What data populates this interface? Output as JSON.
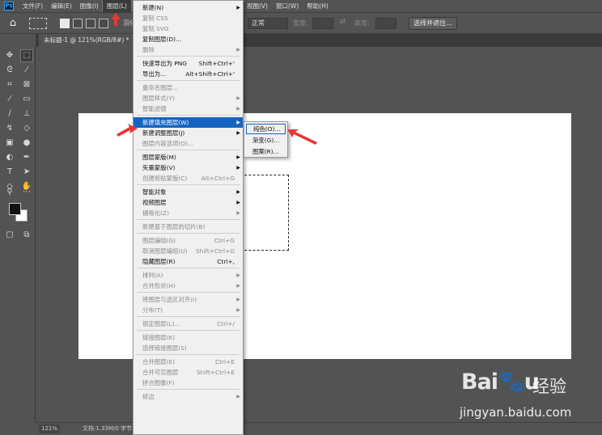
{
  "menubar": {
    "logo": "Ps",
    "items": [
      "文件(F)",
      "编辑(E)",
      "图像(I)",
      "图层(L)"
    ],
    "items_right": [
      "视图(V)",
      "窗口(W)",
      "帮助(H)"
    ]
  },
  "options_bar": {
    "feather_label": "羽化",
    "style_value": "正常",
    "width_label": "宽度:",
    "height_label": "高度:",
    "select_mask_button": "选择并遮住..."
  },
  "tab": {
    "title": "未标题-1 @ 121%(RGB/8#) *"
  },
  "statusbar": {
    "zoom": "121%",
    "doc_info": "文档:1.33M/0 字节",
    "arrow": ">"
  },
  "layer_menu": {
    "items": [
      {
        "label": "新建(N)",
        "shortcut": "",
        "submenu": true,
        "disabled": false
      },
      {
        "label": "复制 CSS",
        "shortcut": "",
        "submenu": false,
        "disabled": true
      },
      {
        "label": "复制 SVG",
        "shortcut": "",
        "submenu": false,
        "disabled": true
      },
      {
        "label": "复制图层(D)...",
        "shortcut": "",
        "submenu": false,
        "disabled": false
      },
      {
        "label": "删除",
        "shortcut": "",
        "submenu": true,
        "disabled": true
      },
      {
        "label": "快速导出为 PNG",
        "shortcut": "Shift+Ctrl+'",
        "submenu": false,
        "disabled": false
      },
      {
        "label": "导出为...",
        "shortcut": "Alt+Shift+Ctrl+'",
        "submenu": false,
        "disabled": false
      },
      {
        "label": "重命名图层...",
        "shortcut": "",
        "submenu": false,
        "disabled": true
      },
      {
        "label": "图层样式(Y)",
        "shortcut": "",
        "submenu": true,
        "disabled": true
      },
      {
        "label": "智能滤镜",
        "shortcut": "",
        "submenu": true,
        "disabled": true
      },
      {
        "label": "新建填充图层(W)",
        "shortcut": "",
        "submenu": true,
        "disabled": false,
        "highlighted": true
      },
      {
        "label": "新建调整图层(J)",
        "shortcut": "",
        "submenu": true,
        "disabled": false
      },
      {
        "label": "图层内容选项(O)...",
        "shortcut": "",
        "submenu": false,
        "disabled": true
      },
      {
        "label": "图层蒙版(M)",
        "shortcut": "",
        "submenu": true,
        "disabled": false
      },
      {
        "label": "矢量蒙版(V)",
        "shortcut": "",
        "submenu": true,
        "disabled": false
      },
      {
        "label": "创建剪贴蒙版(C)",
        "shortcut": "Alt+Ctrl+G",
        "submenu": false,
        "disabled": true
      },
      {
        "label": "智能对象",
        "shortcut": "",
        "submenu": true,
        "disabled": false
      },
      {
        "label": "视频图层",
        "shortcut": "",
        "submenu": true,
        "disabled": false
      },
      {
        "label": "栅格化(Z)",
        "shortcut": "",
        "submenu": true,
        "disabled": true
      },
      {
        "label": "新建基于图层的切片(B)",
        "shortcut": "",
        "submenu": false,
        "disabled": true
      },
      {
        "label": "图层编组(G)",
        "shortcut": "Ctrl+G",
        "submenu": false,
        "disabled": true
      },
      {
        "label": "取消图层编组(U)",
        "shortcut": "Shift+Ctrl+G",
        "submenu": false,
        "disabled": true
      },
      {
        "label": "隐藏图层(R)",
        "shortcut": "Ctrl+,",
        "submenu": false,
        "disabled": false
      },
      {
        "label": "排列(A)",
        "shortcut": "",
        "submenu": true,
        "disabled": true
      },
      {
        "label": "合并形状(H)",
        "shortcut": "",
        "submenu": true,
        "disabled": true
      },
      {
        "label": "将图层与选区对齐(I)",
        "shortcut": "",
        "submenu": true,
        "disabled": true
      },
      {
        "label": "分布(T)",
        "shortcut": "",
        "submenu": true,
        "disabled": true
      },
      {
        "label": "锁定图层(L)...",
        "shortcut": "Ctrl+/",
        "submenu": false,
        "disabled": true
      },
      {
        "label": "链接图层(K)",
        "shortcut": "",
        "submenu": false,
        "disabled": true
      },
      {
        "label": "选择链接图层(S)",
        "shortcut": "",
        "submenu": false,
        "disabled": true
      },
      {
        "label": "合并图层(E)",
        "shortcut": "Ctrl+E",
        "submenu": false,
        "disabled": true
      },
      {
        "label": "合并可见图层",
        "shortcut": "Shift+Ctrl+E",
        "submenu": false,
        "disabled": true
      },
      {
        "label": "拼合图像(F)",
        "shortcut": "",
        "submenu": false,
        "disabled": true
      },
      {
        "label": "修边",
        "shortcut": "",
        "submenu": true,
        "disabled": true
      }
    ]
  },
  "fill_submenu": {
    "items": [
      "纯色(O)...",
      "渐变(G)...",
      "图案(R)..."
    ]
  },
  "watermark": {
    "logo": "Bai du 经验",
    "url": "jingyan.baidu.com"
  },
  "colors": {
    "ui_bg": "#535353",
    "menu_bg": "#f0f0f0",
    "highlight": "#1565c0",
    "annotation_arrow": "#e53935"
  }
}
